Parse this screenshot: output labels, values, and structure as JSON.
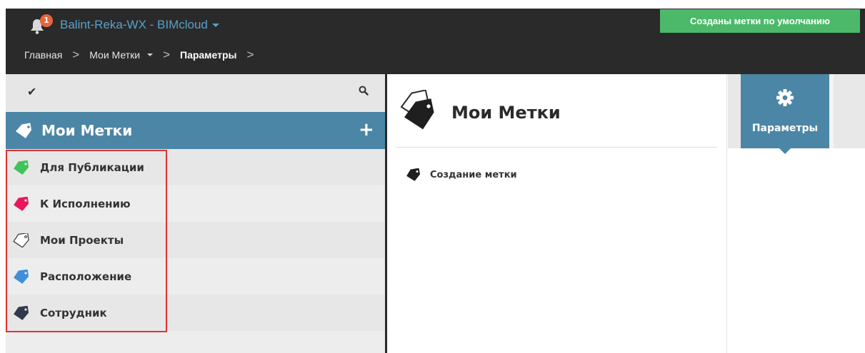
{
  "header": {
    "notification_count": "1",
    "project_title": "Balint-Reka-WX - BIMcloud",
    "notice": "Созданы метки по умолчанию"
  },
  "breadcrumb": {
    "home": "Главная",
    "my_tags": "Мои Метки",
    "current": "Параметры",
    "separator": ">"
  },
  "left_panel": {
    "title": "Мои Метки",
    "add_label": "+",
    "tags": [
      {
        "label": "Для Публикации",
        "color": "#3fc35a"
      },
      {
        "label": "К Исполнению",
        "color": "#e8185c"
      },
      {
        "label": "Мои Проекты",
        "color": "#ffffff"
      },
      {
        "label": "Расположение",
        "color": "#3e8fd6"
      },
      {
        "label": "Сотрудник",
        "color": "#2f3a4a"
      }
    ]
  },
  "middle_panel": {
    "title": "Мои Метки",
    "create_tag": "Создание метки"
  },
  "right_panel": {
    "tab_label": "Параметры"
  },
  "colors": {
    "accent": "#4b86a6",
    "topbar": "#2a2a2a",
    "notice_bg": "#4cb96a",
    "highlight": "#e03333"
  }
}
